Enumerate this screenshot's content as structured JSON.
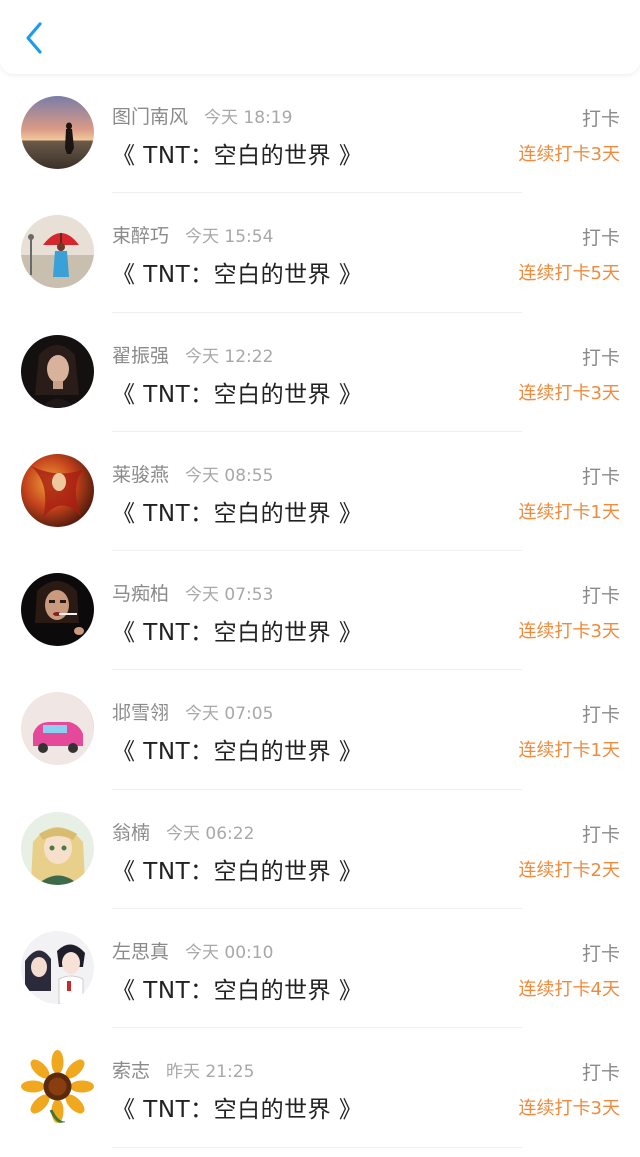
{
  "header": {
    "back_icon": "chevron-left-icon",
    "accent_color": "#1e9be9"
  },
  "colors": {
    "streak": "#f08a3c",
    "name": "#8a8a8a",
    "title": "#222222"
  },
  "items": [
    {
      "name": "图门南风",
      "time": "今天 18:19",
      "title": "《 TNT：空白的世界 》",
      "action": "打卡",
      "streak": "连续打卡3天",
      "avatar": "sunset-silhouette-avatar"
    },
    {
      "name": "束醉巧",
      "time": "今天 15:54",
      "title": "《 TNT：空白的世界 》",
      "action": "打卡",
      "streak": "连续打卡5天",
      "avatar": "red-umbrella-avatar"
    },
    {
      "name": "翟振强",
      "time": "今天 12:22",
      "title": "《 TNT：空白的世界 》",
      "action": "打卡",
      "streak": "连续打卡3天",
      "avatar": "dark-portrait-avatar"
    },
    {
      "name": "莱骏燕",
      "time": "今天 08:55",
      "title": "《 TNT：空白的世界 》",
      "action": "打卡",
      "streak": "连续打卡1天",
      "avatar": "fire-hair-avatar"
    },
    {
      "name": "马痴柏",
      "time": "今天 07:53",
      "title": "《 TNT：空白的世界 》",
      "action": "打卡",
      "streak": "连续打卡3天",
      "avatar": "smoking-portrait-avatar"
    },
    {
      "name": "邶雪翎",
      "time": "今天 07:05",
      "title": "《 TNT：空白的世界 》",
      "action": "打卡",
      "streak": "连续打卡1天",
      "avatar": "pink-toy-car-avatar"
    },
    {
      "name": "翁楠",
      "time": "今天 06:22",
      "title": "《 TNT：空白的世界 》",
      "action": "打卡",
      "streak": "连续打卡2天",
      "avatar": "anime-girl-avatar"
    },
    {
      "name": "左思真",
      "time": "今天 00:10",
      "title": "《 TNT：空白的世界 》",
      "action": "打卡",
      "streak": "连续打卡4天",
      "avatar": "couple-illustration-avatar"
    },
    {
      "name": "索志",
      "time": "昨天 21:25",
      "title": "《 TNT：空白的世界 》",
      "action": "打卡",
      "streak": "连续打卡3天",
      "avatar": "sunflower-avatar"
    }
  ]
}
